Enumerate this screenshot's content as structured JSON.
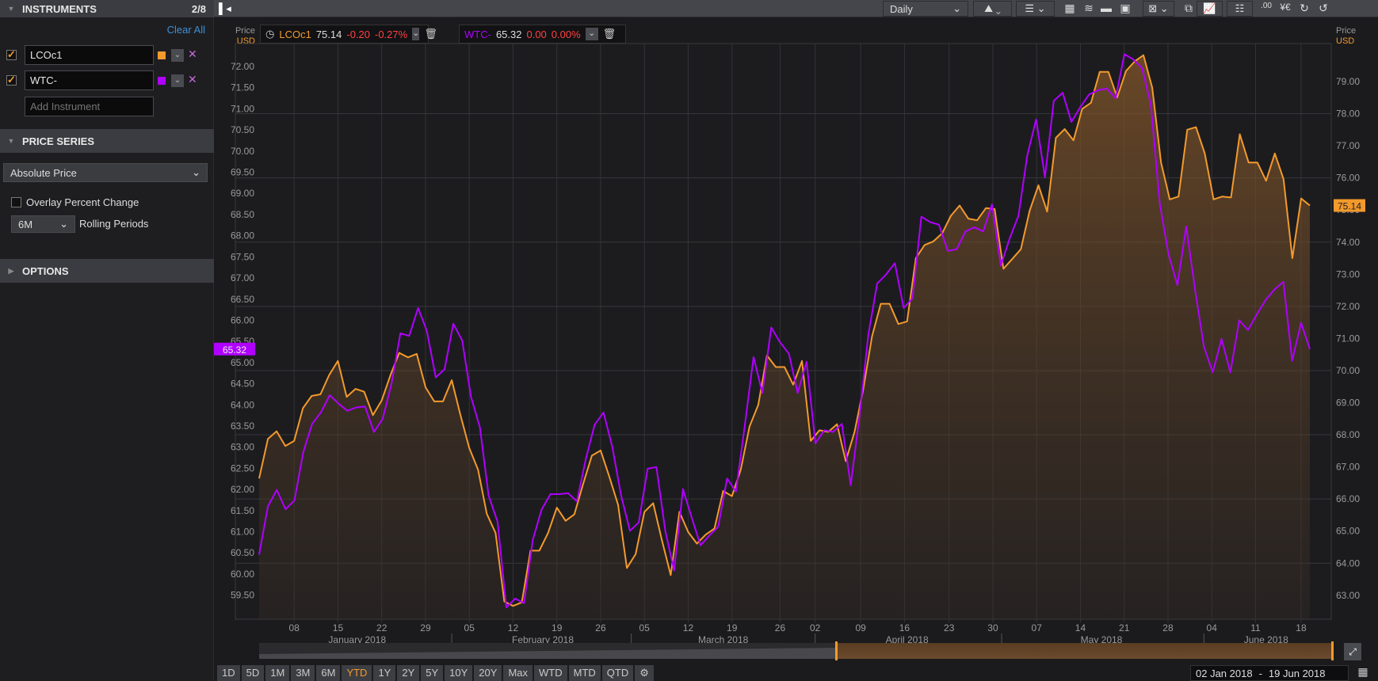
{
  "sidebar": {
    "instruments_header": "INSTRUMENTS",
    "instruments_count": "2/8",
    "clear_all": "Clear All",
    "instruments": [
      {
        "name": "LCOc1",
        "color": "#f39a2c"
      },
      {
        "name": "WTC-",
        "color": "#b000ff"
      }
    ],
    "add_instrument_placeholder": "Add Instrument",
    "price_series_header": "PRICE SERIES",
    "price_type": "Absolute Price",
    "overlay_label": "Overlay Percent Change",
    "rolling_value": "6M",
    "rolling_label": "Rolling Periods",
    "options_header": "OPTIONS"
  },
  "toolbar": {
    "interval": "Daily",
    "icons": [
      "chart-type-icon",
      "list-icon",
      "compare-icon",
      "studies-icon",
      "folder-icon",
      "save-icon",
      "excel-icon",
      "copy-icon",
      "chart-export-icon",
      "grid-icon",
      "decimals-icon",
      "currency-icon",
      "refresh-icon",
      "history-icon"
    ]
  },
  "legend": [
    {
      "ric": "LCOc1",
      "last": "75.14",
      "change": "-0.20",
      "pct": "-0.27%"
    },
    {
      "ric": "WTC-",
      "last": "65.32",
      "change": "0.00",
      "pct": "0.00%"
    }
  ],
  "axis_titles": {
    "left_price": "Price",
    "left_ccy": "USD",
    "right_price": "Price",
    "right_ccy": "USD"
  },
  "periods": [
    "1D",
    "5D",
    "1M",
    "3M",
    "6M",
    "YTD",
    "1Y",
    "2Y",
    "5Y",
    "10Y",
    "20Y",
    "Max",
    "WTD",
    "MTD",
    "QTD"
  ],
  "active_period": "YTD",
  "date_range": {
    "start": "02 Jan 2018",
    "sep": "-",
    "end": "19 Jun 2018"
  },
  "colors": {
    "brent": "#f39a2c",
    "wti": "#b000ff"
  },
  "chart_data": {
    "type": "line",
    "x_unit": "trading day index from 02 Jan 2018",
    "left_axis": {
      "series": "WTC-",
      "range": [
        59.5,
        72.0
      ],
      "ticks": [
        "59.50",
        "60.00",
        "60.50",
        "61.00",
        "61.50",
        "62.00",
        "62.50",
        "63.00",
        "63.50",
        "64.00",
        "64.50",
        "65.00",
        "65.50",
        "66.00",
        "66.50",
        "67.00",
        "67.50",
        "68.00",
        "68.50",
        "69.00",
        "69.50",
        "70.00",
        "70.50",
        "71.00",
        "71.50",
        "72.00"
      ]
    },
    "right_axis": {
      "series": "LCOc1",
      "range": [
        63.0,
        79.0
      ],
      "ticks": [
        "63.00",
        "64.00",
        "65.00",
        "66.00",
        "67.00",
        "68.00",
        "69.00",
        "70.00",
        "71.00",
        "72.00",
        "73.00",
        "74.00",
        "75.00",
        "76.00",
        "77.00",
        "78.00",
        "79.00"
      ]
    },
    "grid_values_right": [
      64,
      66,
      68,
      70,
      72,
      74,
      76,
      78
    ],
    "x_ticks": [
      {
        "label": "08",
        "x": 4
      },
      {
        "label": "15",
        "x": 9
      },
      {
        "label": "22",
        "x": 14
      },
      {
        "label": "29",
        "x": 19
      },
      {
        "label": "05",
        "x": 24
      },
      {
        "label": "12",
        "x": 29
      },
      {
        "label": "19",
        "x": 34
      },
      {
        "label": "26",
        "x": 39
      },
      {
        "label": "05",
        "x": 44
      },
      {
        "label": "12",
        "x": 49
      },
      {
        "label": "19",
        "x": 54
      },
      {
        "label": "26",
        "x": 59.5
      },
      {
        "label": "02",
        "x": 63.5
      },
      {
        "label": "09",
        "x": 68.7
      },
      {
        "label": "16",
        "x": 73.7
      },
      {
        "label": "23",
        "x": 78.8
      },
      {
        "label": "30",
        "x": 83.8
      },
      {
        "label": "07",
        "x": 88.8
      },
      {
        "label": "14",
        "x": 93.8
      },
      {
        "label": "21",
        "x": 98.8
      },
      {
        "label": "28",
        "x": 103.8
      },
      {
        "label": "04",
        "x": 108.8
      },
      {
        "label": "11",
        "x": 113.8
      },
      {
        "label": "18",
        "x": 119
      }
    ],
    "months": [
      {
        "label": "January 2018",
        "x": 11.2
      },
      {
        "label": "February 2018",
        "x": 32.4
      },
      {
        "label": "March 2018",
        "x": 53
      },
      {
        "label": "April 2018",
        "x": 74
      },
      {
        "label": "May 2018",
        "x": 96.2
      },
      {
        "label": "June 2018",
        "x": 115
      }
    ],
    "month_separators": [
      22,
      42.5,
      63.5,
      84.8,
      107.9
    ],
    "x_range": [
      0,
      120
    ],
    "series": [
      {
        "name": "LCOc1",
        "axis": "right",
        "last_label": "75.14",
        "values": [
          66.64,
          67.87,
          68.11,
          67.65,
          67.81,
          68.83,
          69.21,
          69.26,
          69.86,
          70.3,
          69.18,
          69.43,
          69.34,
          68.61,
          69.07,
          69.86,
          70.55,
          70.41,
          70.52,
          69.48,
          69.04,
          69.04,
          69.7,
          68.61,
          67.59,
          66.91,
          65.54,
          64.94,
          62.81,
          62.67,
          62.78,
          64.39,
          64.39,
          64.94,
          65.73,
          65.32,
          65.52,
          66.47,
          67.35,
          67.51,
          66.69,
          65.82,
          63.85,
          64.28,
          65.6,
          65.87,
          64.72,
          63.63,
          65.6,
          64.97,
          64.61,
          64.89,
          65.08,
          66.25,
          66.09,
          66.91,
          68.25,
          68.93,
          70.47,
          70.11,
          70.11,
          69.56,
          70.3,
          67.81,
          68.14,
          68.09,
          68.33,
          67.18,
          68.09,
          69.43,
          71.07,
          72.08,
          72.08,
          71.45,
          71.53,
          73.5,
          73.91,
          74.02,
          74.27,
          74.82,
          75.14,
          74.73,
          74.68,
          75.06,
          75.03,
          73.17,
          73.47,
          73.78,
          74.98,
          75.77,
          74.95,
          77.25,
          77.52,
          77.17,
          78.15,
          78.34,
          79.3,
          79.3,
          78.51,
          79.33,
          79.63,
          79.82,
          78.81,
          76.48,
          75.33,
          75.42,
          77.5,
          77.58,
          76.76,
          75.33,
          75.42,
          75.39,
          77.36,
          76.48,
          76.48,
          75.91,
          76.76,
          75.96,
          73.5,
          75.36,
          75.14
        ]
      },
      {
        "name": "WTC-",
        "axis": "left",
        "last_label": "65.32",
        "values": [
          60.46,
          61.6,
          61.99,
          61.53,
          61.74,
          62.88,
          63.55,
          63.82,
          64.23,
          64.03,
          63.86,
          63.94,
          63.96,
          63.36,
          63.67,
          64.5,
          65.69,
          65.63,
          66.29,
          65.75,
          64.65,
          64.84,
          65.92,
          65.52,
          64.19,
          63.47,
          61.85,
          61.24,
          59.21,
          59.42,
          59.31,
          60.81,
          61.53,
          61.89,
          61.89,
          61.91,
          61.72,
          62.72,
          63.53,
          63.82,
          63.01,
          61.85,
          61.02,
          61.22,
          62.49,
          62.53,
          61.02,
          60.08,
          62.01,
          61.33,
          60.68,
          60.91,
          61.12,
          62.26,
          61.95,
          63.51,
          65.13,
          64.28,
          65.83,
          65.48,
          65.21,
          64.28,
          65.02,
          63.09,
          63.4,
          63.36,
          63.55,
          62.1,
          63.74,
          65.67,
          66.87,
          67.08,
          67.35,
          66.29,
          66.52,
          68.45,
          68.32,
          68.26,
          67.64,
          67.68,
          68.1,
          68.2,
          68.1,
          68.74,
          67.29,
          67.93,
          68.47,
          69.9,
          70.75,
          69.38,
          71.19,
          71.38,
          70.69,
          71.04,
          71.34,
          71.44,
          71.48,
          71.25,
          72.29,
          72.17,
          71.96,
          71.09,
          68.76,
          67.56,
          66.83,
          68.22,
          66.73,
          65.38,
          64.77,
          65.56,
          64.77,
          66.0,
          65.77,
          66.14,
          66.48,
          66.73,
          66.91,
          65.04,
          65.94,
          65.32
        ]
      }
    ]
  }
}
